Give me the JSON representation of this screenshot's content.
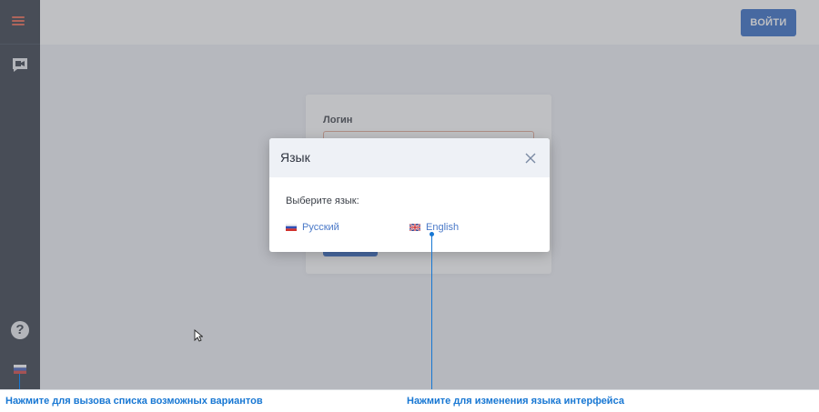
{
  "header": {
    "login_button": "ВОЙТИ"
  },
  "login_form": {
    "login_label": "Логин"
  },
  "sidebar": {
    "menu_icon": "hamburger-menu-icon",
    "video_icon": "video-chat-icon",
    "help_icon": "help-icon",
    "help_glyph": "?",
    "language_icon": "russian-flag-icon"
  },
  "modal": {
    "title": "Язык",
    "prompt": "Выберите язык:",
    "options": [
      {
        "label": "Русский",
        "icon": "russian-flag-icon"
      },
      {
        "label": "English",
        "icon": "uk-flag-icon"
      }
    ],
    "close_icon": "close-icon"
  },
  "annotations": {
    "language_button_hint": "Нажмите для вызова списка возможных вариантов",
    "language_option_hint": "Нажмите для изменения языка интерфейса"
  },
  "colors": {
    "sidebar_bg": "#1f2733",
    "accent": "#1e5bbf",
    "menu_icon": "#e0533b",
    "link": "#4a79c8",
    "annotation": "#1777d3"
  }
}
